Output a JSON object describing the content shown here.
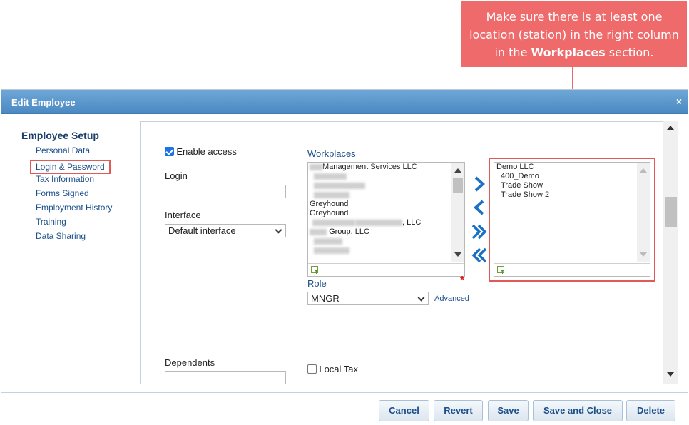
{
  "callout": {
    "line1": "Make sure there is at least one",
    "line2": "location (station) in the right column",
    "line3_prefix": "in the ",
    "line3_bold": "Workplaces",
    "line3_suffix": " section."
  },
  "dialog": {
    "title": "Edit Employee",
    "close_label": "×"
  },
  "nav": {
    "heading": "Employee Setup",
    "items": [
      {
        "label": "Personal Data"
      },
      {
        "label": "Login & Password",
        "active": true
      },
      {
        "label": "Tax Information"
      },
      {
        "label": "Forms Signed"
      },
      {
        "label": "Employment History"
      },
      {
        "label": "Training"
      },
      {
        "label": "Data Sharing"
      }
    ]
  },
  "form": {
    "enable_access_label": "Enable access",
    "enable_access_checked": true,
    "login_label": "Login",
    "login_value": "",
    "interface_label": "Interface",
    "interface_value": "Default interface",
    "workplaces_label": "Workplaces",
    "available_workplaces": [
      "Management Services LLC",
      "",
      "",
      "Greyhound",
      "Greyhound",
      ", LLC",
      "Group, LLC",
      "",
      ""
    ],
    "selected_workplaces": [
      "Demo LLC",
      "400_Demo",
      "Trade Show",
      "Trade Show 2"
    ],
    "role_label": "Role",
    "role_value": "MNGR",
    "advanced_label": "Advanced",
    "dependents_label": "Dependents",
    "local_tax_label": "Local Tax",
    "local_tax_checked": false
  },
  "buttons": {
    "cancel": "Cancel",
    "revert": "Revert",
    "save": "Save",
    "save_close": "Save and Close",
    "delete": "Delete"
  },
  "colors": {
    "callout": "#ef6a6a",
    "highlight_border": "#e05a5a",
    "title_bar": "#4b89c2",
    "link": "#1d4f8a",
    "arrow": "#1c6fc7"
  }
}
